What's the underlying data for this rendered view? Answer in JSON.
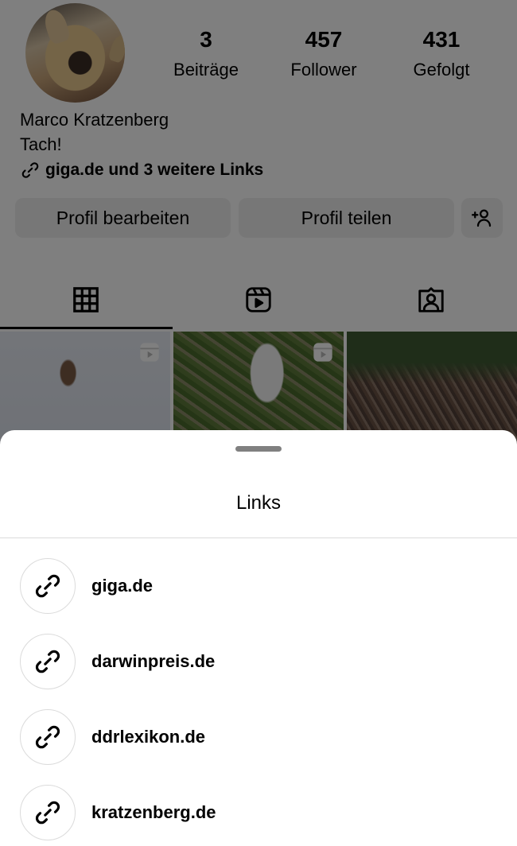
{
  "profile": {
    "name": "Marco Kratzenberg",
    "bio": "Tach!",
    "bio_link": "giga.de und 3 weitere Links",
    "stats": [
      {
        "value": "3",
        "label": "Beiträge"
      },
      {
        "value": "457",
        "label": "Follower"
      },
      {
        "value": "431",
        "label": "Gefolgt"
      }
    ]
  },
  "actions": {
    "edit_label": "Profil bearbeiten",
    "share_label": "Profil teilen",
    "add_person_icon": "person-add-icon"
  },
  "tabs": [
    {
      "name": "posts",
      "icon": "grid-icon",
      "active": true
    },
    {
      "name": "reels",
      "icon": "reels-icon",
      "active": false
    },
    {
      "name": "tagged",
      "icon": "tagged-person-icon",
      "active": false
    }
  ],
  "posts": [
    {
      "kind": "reel",
      "description": "dogs in snow"
    },
    {
      "kind": "reel",
      "description": "two dogs on grass"
    },
    {
      "kind": "photo",
      "description": "path covered in leaves"
    }
  ],
  "sheet": {
    "title": "Links",
    "links": [
      {
        "label": "giga.de",
        "icon": "link-icon"
      },
      {
        "label": "darwinpreis.de",
        "icon": "link-icon"
      },
      {
        "label": "ddrlexikon.de",
        "icon": "link-icon"
      },
      {
        "label": "kratzenberg.de",
        "icon": "link-icon"
      }
    ]
  },
  "colors": {
    "overlay": "#000000",
    "button_bg": "#efefef",
    "divider": "#dbdbdb",
    "handle": "#808080"
  }
}
